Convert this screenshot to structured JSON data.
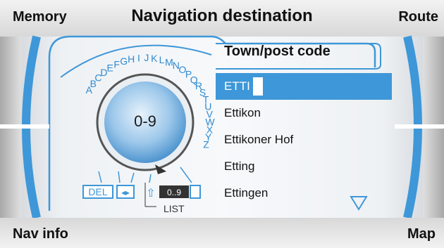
{
  "header": {
    "title": "Navigation destination",
    "left_label": "Memory",
    "right_label": "Route"
  },
  "footer": {
    "left_label": "Nav info",
    "right_label": "Map"
  },
  "speller": {
    "field_title": "Town/post code",
    "wheel_center": "0-9",
    "letters": [
      "A",
      "B",
      "C",
      "D",
      "E",
      "F",
      "G",
      "H",
      "I",
      "J",
      "K",
      "L",
      "M",
      "N",
      "O",
      "P",
      "Q",
      "R",
      "S",
      "T",
      "U",
      "V",
      "W",
      "X",
      "Y",
      "Z"
    ],
    "del_label": "DEL",
    "numbers_label": "0..9",
    "list_label": "LIST"
  },
  "results": [
    {
      "label": "ETTI",
      "selected": true
    },
    {
      "label": "Ettikon",
      "selected": false
    },
    {
      "label": "Ettikoner Hof",
      "selected": false
    },
    {
      "label": "Etting",
      "selected": false
    },
    {
      "label": "Ettingen",
      "selected": false
    }
  ],
  "colors": {
    "accent": "#3e97d8",
    "accent_dark": "#1f6fae",
    "bar": "#d8d8d8"
  }
}
